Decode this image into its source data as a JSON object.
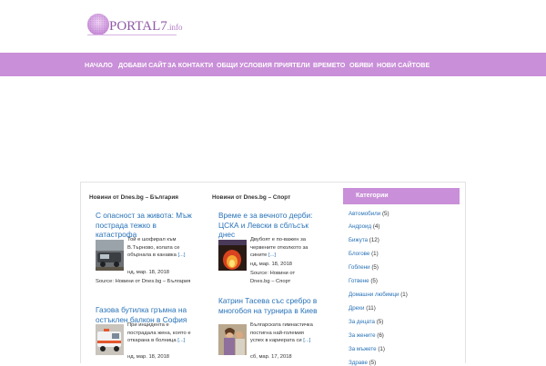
{
  "header": {
    "logo_text": "PORTAL7",
    "logo_sub": ".info"
  },
  "nav": {
    "items": [
      {
        "label": "НАЧАЛО"
      },
      {
        "label": "ДОБАВИ САЙТ"
      },
      {
        "label": "ЗА КОНТАКТИ"
      },
      {
        "label": "ОБЩИ УСЛОВИЯ"
      },
      {
        "label": "ПРИЯТЕЛИ"
      },
      {
        "label": "ВРЕМЕТО"
      },
      {
        "label": "ОБЯВИ"
      },
      {
        "label": "НОВИ САЙТОВЕ"
      }
    ]
  },
  "col_bg": {
    "heading": "Новини от Dnes.bg – България",
    "posts": [
      {
        "title": "С опасност за живота: Мъж пострада тежко в катастрофа",
        "excerpt": "Той е шофирал към В.Търново, колата се обърнала в канавка",
        "more": "[...]",
        "date": "нд, мар. 18, 2018",
        "source": "Source: Новини от Dnes.bg – България"
      },
      {
        "title": "Газова бутилка гръмна на остъклен балкон в София",
        "excerpt": "При инцидента е пострадала жена, която е откарана в болница",
        "more": "[...]",
        "date": "нд, мар. 18, 2018"
      }
    ]
  },
  "col_sport": {
    "heading": "Новини от Dnes.bg – Спорт",
    "posts": [
      {
        "title": "Време е за вечното дерби: ЦСКА и Левски в сблъсък днес",
        "excerpt": "Двубоят е по-важен за червените отколкото за сините",
        "more": "[...]",
        "date": "нд, мар. 18, 2018",
        "source": "Source: Новини от Dnes.bg – Спорт"
      },
      {
        "title": "Катрин Тасева със сребро в многобоя на турнира в Киев",
        "excerpt": "Българската гимнастичка постигна най-големия успех в кариерата си",
        "more": "[...]",
        "date": "сб, мар. 17, 2018"
      }
    ]
  },
  "sidebar": {
    "heading": "Категории",
    "categories": [
      {
        "name": "Автомобили",
        "count": "(5)"
      },
      {
        "name": "Андроид",
        "count": "(4)"
      },
      {
        "name": "Бижута",
        "count": "(12)"
      },
      {
        "name": "Блогове",
        "count": "(1)"
      },
      {
        "name": "Гоблени",
        "count": "(5)"
      },
      {
        "name": "Готвене",
        "count": "(5)"
      },
      {
        "name": "Домашни любимци",
        "count": "(1)"
      },
      {
        "name": "Дрехи",
        "count": "(11)"
      },
      {
        "name": "За децата",
        "count": "(5)"
      },
      {
        "name": "За жените",
        "count": "(6)"
      },
      {
        "name": "За мъжете",
        "count": "(1)"
      },
      {
        "name": "Здраве",
        "count": "(5)"
      }
    ]
  },
  "colors": {
    "accent": "#c98fd8",
    "link": "#2772b8",
    "logo": "#8f5aa6"
  }
}
